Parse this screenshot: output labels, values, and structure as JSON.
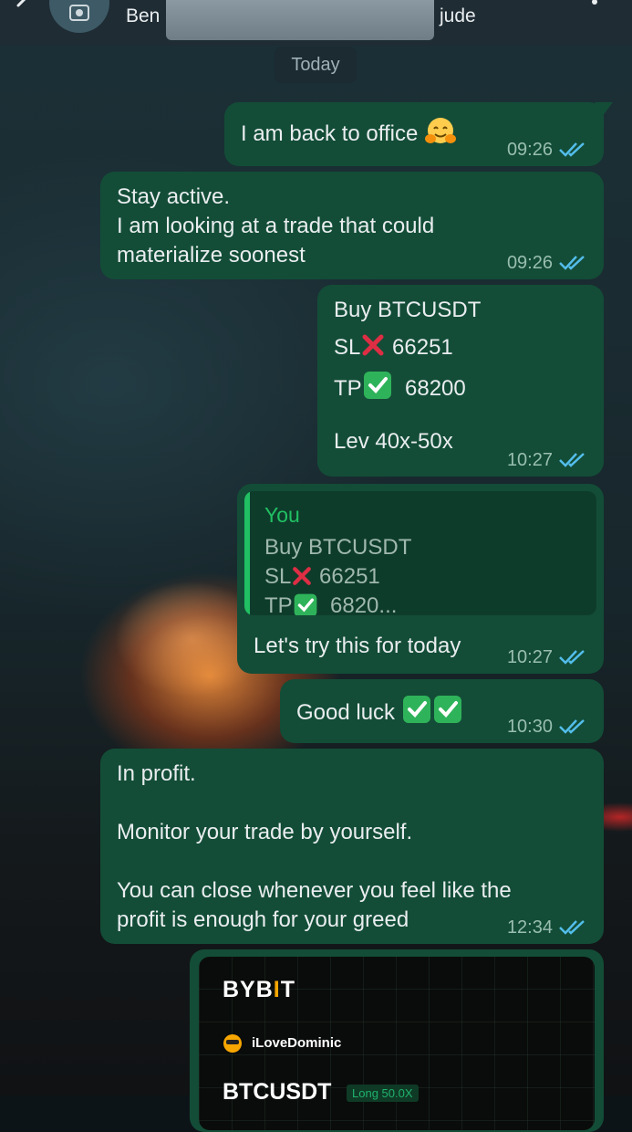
{
  "header": {
    "contact_name_prefix": "Ben",
    "contact_name_suffix": "jude",
    "icons": [
      "back-arrow-icon",
      "avatar-icon",
      "more-vertical-icon"
    ]
  },
  "date_chip": "Today",
  "messages": [
    {
      "lines": [
        "I am back to office"
      ],
      "emoji": "hugging-face",
      "time": "09:26"
    },
    {
      "lines": [
        "Stay active.",
        "I am looking at a trade that could",
        "materialize soonest"
      ],
      "time": "09:26"
    },
    {
      "lines": [
        "Buy BTCUSDT",
        "SL",
        "66251",
        "TP",
        "68200",
        "Lev 40x-50x"
      ],
      "time": "10:27"
    },
    {
      "quote": {
        "author": "You",
        "lines": [
          "Buy BTCUSDT",
          "SL",
          "66251",
          "TP",
          "6820..."
        ]
      },
      "lines": [
        "Let's try this for today"
      ],
      "time": "10:27"
    },
    {
      "lines": [
        "Good luck"
      ],
      "emoji": "check-mark-x2",
      "time": "10:30"
    },
    {
      "lines": [
        "In profit.",
        "Monitor your trade by yourself.",
        "You can close whenever you feel like the",
        "profit is enough for your greed"
      ],
      "time": "12:34"
    }
  ],
  "card": {
    "logo_pre": "BYB",
    "logo_accent": "I",
    "logo_post": "T",
    "username": "iLoveDominic",
    "symbol": "BTCUSDT",
    "badge": "Long 50.0X"
  },
  "colors": {
    "header_bg": "#1f2c34",
    "bubble_out": "#134d37",
    "tick_read": "#53bdeb",
    "quote_accent": "#21c063",
    "bybit_accent": "#f7a600"
  }
}
